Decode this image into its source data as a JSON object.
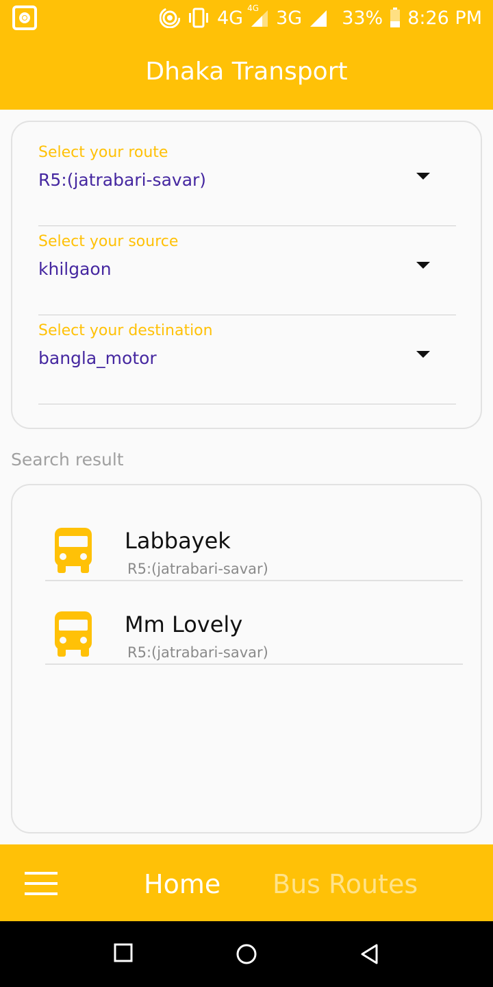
{
  "status_bar": {
    "network_4g": "4G",
    "network_4g_small": "4G",
    "network_3g": "3G",
    "battery": "33%",
    "time": "8:26 PM"
  },
  "app_bar": {
    "title": "Dhaka Transport"
  },
  "form": {
    "route": {
      "label": "Select your route",
      "value": "R5:(jatrabari-savar)"
    },
    "source": {
      "label": "Select your source",
      "value": "khilgaon"
    },
    "destination": {
      "label": "Select your destination",
      "value": "bangla_motor"
    }
  },
  "results": {
    "title": "Search result",
    "items": [
      {
        "name": "Labbayek",
        "route": "R5:(jatrabari-savar)"
      },
      {
        "name": "Mm Lovely",
        "route": "R5:(jatrabari-savar)"
      }
    ]
  },
  "bottom_nav": {
    "home_label": "Home",
    "routes_label": "Bus Routes"
  },
  "colors": {
    "primary": "#FFC107",
    "value_text": "#4527A0",
    "inactive_tab": "#FFE38A"
  }
}
